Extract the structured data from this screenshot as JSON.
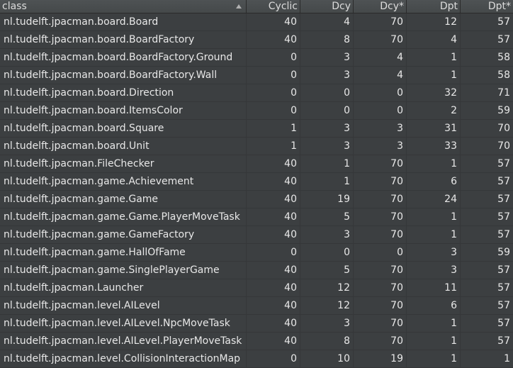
{
  "columns": [
    "class",
    "Cyclic",
    "Dcy",
    "Dcy*",
    "Dpt",
    "Dpt*"
  ],
  "sort": {
    "column": "class",
    "icon": "sort-ascending-icon"
  },
  "rows": [
    [
      "nl.tudelft.jpacman.board.Board",
      "40",
      "4",
      "70",
      "12",
      "57"
    ],
    [
      "nl.tudelft.jpacman.board.BoardFactory",
      "40",
      "8",
      "70",
      "4",
      "57"
    ],
    [
      "nl.tudelft.jpacman.board.BoardFactory.Ground",
      "0",
      "3",
      "4",
      "1",
      "58"
    ],
    [
      "nl.tudelft.jpacman.board.BoardFactory.Wall",
      "0",
      "3",
      "4",
      "1",
      "58"
    ],
    [
      "nl.tudelft.jpacman.board.Direction",
      "0",
      "0",
      "0",
      "32",
      "71"
    ],
    [
      "nl.tudelft.jpacman.board.ItemsColor",
      "0",
      "0",
      "0",
      "2",
      "59"
    ],
    [
      "nl.tudelft.jpacman.board.Square",
      "1",
      "3",
      "3",
      "31",
      "70"
    ],
    [
      "nl.tudelft.jpacman.board.Unit",
      "1",
      "3",
      "3",
      "33",
      "70"
    ],
    [
      "nl.tudelft.jpacman.FileChecker",
      "40",
      "1",
      "70",
      "1",
      "57"
    ],
    [
      "nl.tudelft.jpacman.game.Achievement",
      "40",
      "1",
      "70",
      "6",
      "57"
    ],
    [
      "nl.tudelft.jpacman.game.Game",
      "40",
      "19",
      "70",
      "24",
      "57"
    ],
    [
      "nl.tudelft.jpacman.game.Game.PlayerMoveTask",
      "40",
      "5",
      "70",
      "1",
      "57"
    ],
    [
      "nl.tudelft.jpacman.game.GameFactory",
      "40",
      "3",
      "70",
      "1",
      "57"
    ],
    [
      "nl.tudelft.jpacman.game.HallOfFame",
      "0",
      "0",
      "0",
      "3",
      "59"
    ],
    [
      "nl.tudelft.jpacman.game.SinglePlayerGame",
      "40",
      "5",
      "70",
      "3",
      "57"
    ],
    [
      "nl.tudelft.jpacman.Launcher",
      "40",
      "12",
      "70",
      "11",
      "57"
    ],
    [
      "nl.tudelft.jpacman.level.AILevel",
      "40",
      "12",
      "70",
      "6",
      "57"
    ],
    [
      "nl.tudelft.jpacman.level.AILevel.NpcMoveTask",
      "40",
      "3",
      "70",
      "1",
      "57"
    ],
    [
      "nl.tudelft.jpacman.level.AILevel.PlayerMoveTask",
      "40",
      "8",
      "70",
      "1",
      "57"
    ],
    [
      "nl.tudelft.jpacman.level.CollisionInteractionMap",
      "0",
      "10",
      "19",
      "1",
      "1"
    ]
  ],
  "colors": {
    "background": "#3c3f41",
    "header": "#4a4d4f",
    "text": "#e8e8e8",
    "grid": "#353739"
  }
}
